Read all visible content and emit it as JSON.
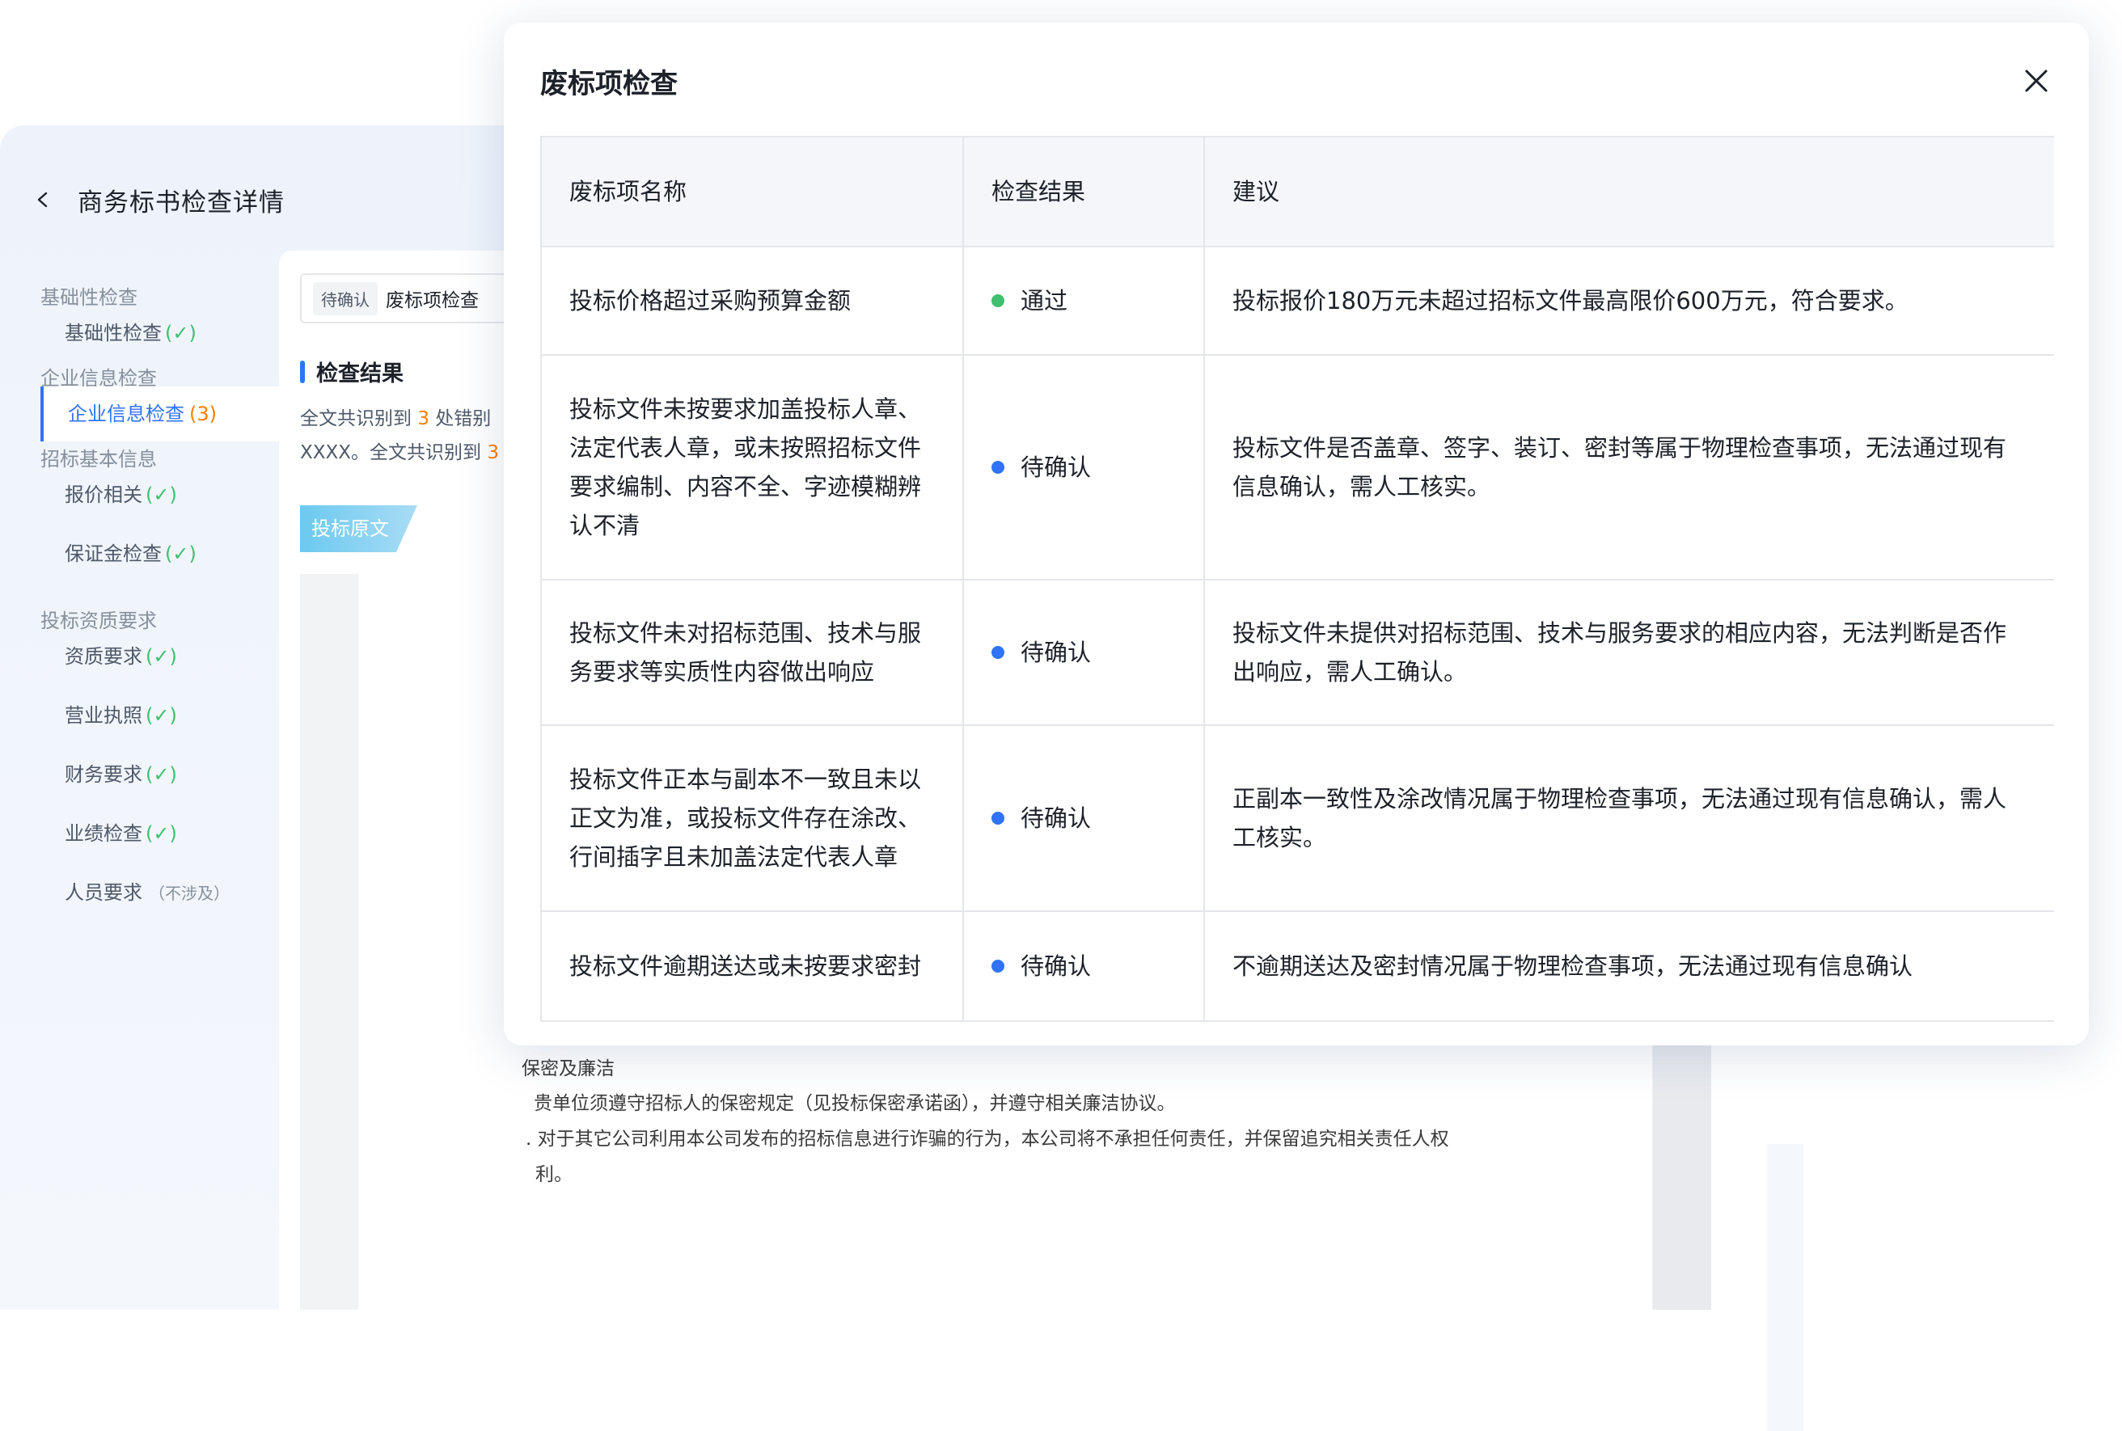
{
  "app": {
    "title": "商务标书检查详情"
  },
  "sidebar": {
    "groups": [
      {
        "title": "基础性检查",
        "items": [
          {
            "label": "基础性检查",
            "mark": "(✓)"
          }
        ]
      },
      {
        "title": "企业信息检查",
        "items": [
          {
            "label": "企业信息检查",
            "mark": "(3)",
            "active": true
          }
        ]
      },
      {
        "title": "招标基本信息",
        "items": [
          {
            "label": "报价相关",
            "mark": "(✓)"
          },
          {
            "label": "保证金检查",
            "mark": "(✓)"
          }
        ]
      },
      {
        "title": "投标资质要求",
        "items": [
          {
            "label": "资质要求",
            "mark": "(✓)"
          },
          {
            "label": "营业执照",
            "mark": "(✓)"
          },
          {
            "label": "财务要求",
            "mark": "(✓)"
          },
          {
            "label": "业绩检查",
            "mark": "(✓)"
          },
          {
            "label": "人员要求",
            "mark": "（不涉及）"
          }
        ]
      }
    ]
  },
  "content": {
    "filter": {
      "tag": "待确认",
      "text": "废标项检查"
    },
    "result": {
      "title": "检查结果",
      "line1_prefix": "全文共识别到",
      "line1_num": "3",
      "line1_suffix": "处错别",
      "line2_prefix": "XXXX。全文共识别到",
      "line2_num": "3"
    },
    "origin_tab": "投标原文",
    "document_lines": [
      "保密及廉洁",
      "贵单位须遵守招标人的保密规定（见投标保密承诺函），并遵守相关廉洁协议。",
      ". 对于其它公司利用本公司发布的招标信息进行诈骗的行为，本公司将不承担任何责任，并保留追究相关责任人权",
      "利。"
    ]
  },
  "modal": {
    "title": "废标项检查",
    "close_icon": "close-icon",
    "columns": [
      "废标项名称",
      "检查结果",
      "建议"
    ],
    "status_colors": {
      "通过": "#3fbf6f",
      "待确认": "#3073f5"
    },
    "rows": [
      {
        "name": "投标价格超过采购预算金额",
        "status": "通过",
        "advice": "投标报价180万元未超过招标文件最高限价600万元，符合要求。"
      },
      {
        "name": "投标文件未按要求加盖投标人章、法定代表人章，或未按照招标文件要求编制、内容不全、字迹模糊辨认不清",
        "status": "待确认",
        "advice": "投标文件是否盖章、签字、装订、密封等属于物理检查事项，无法通过现有信息确认，需人工核实。"
      },
      {
        "name": "投标文件未对招标范围、技术与服务要求等实质性内容做出响应",
        "status": "待确认",
        "advice": "投标文件未提供对招标范围、技术与服务要求的相应内容，无法判断是否作出响应，需人工确认。"
      },
      {
        "name": "投标文件正本与副本不一致且未以正文为准，或投标文件存在涂改、行间插字且未加盖法定代表人章",
        "status": "待确认",
        "advice": "正副本一致性及涂改情况属于物理检查事项，无法通过现有信息确认，需人工核实。"
      },
      {
        "name": "投标文件逾期送达或未按要求密封",
        "status": "待确认",
        "advice": "不逾期送达及密封情况属于物理检查事项，无法通过现有信息确认"
      }
    ]
  }
}
